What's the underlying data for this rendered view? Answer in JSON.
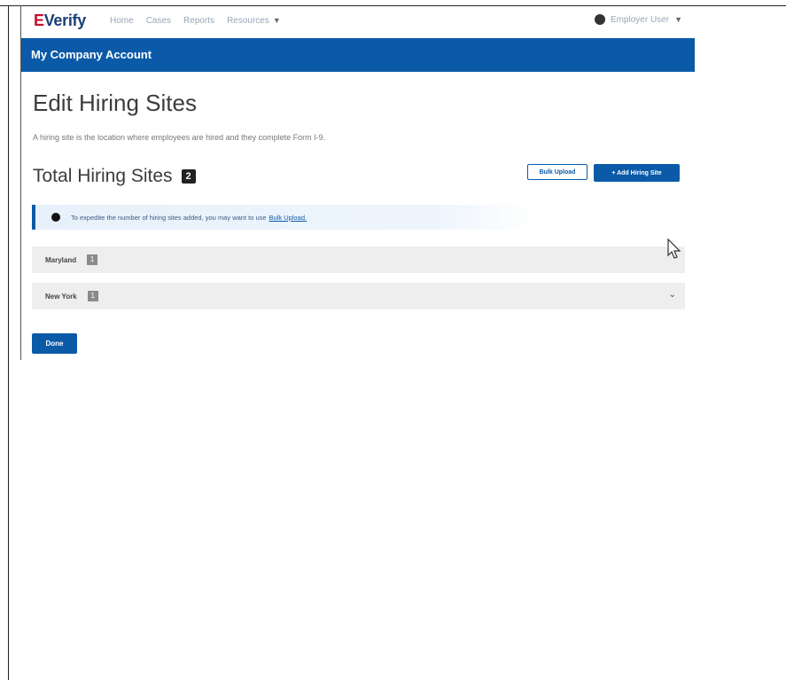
{
  "nav": {
    "logo_prefix": "E",
    "logo_text": "Verify",
    "links": [
      "Home",
      "Cases",
      "Reports",
      "Resources"
    ],
    "user_name": "Employer User"
  },
  "banner": {
    "title": "My Company Account"
  },
  "page": {
    "title": "Edit Hiring Sites",
    "description": "A hiring site is the location where employees are hired and they complete Form I-9."
  },
  "hiring_sites": {
    "heading": "Total Hiring Sites",
    "count": "2",
    "bulk_upload_label": "Bulk Upload",
    "add_site_label": "+ Add Hiring Site"
  },
  "alert": {
    "text": "To expedite the number of hiring sites added, you may want to use",
    "link_text": "Bulk Upload."
  },
  "sites": [
    {
      "name": "Maryland",
      "count": "1"
    },
    {
      "name": "New York",
      "count": "1"
    }
  ],
  "footer": {
    "done_label": "Done"
  },
  "colors": {
    "primary": "#0b5aa8",
    "logo_red": "#c8102e"
  }
}
